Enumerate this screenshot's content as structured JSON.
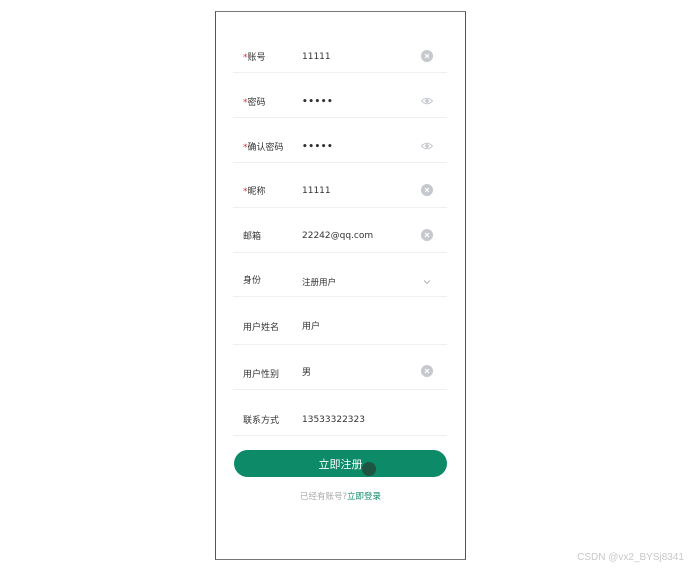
{
  "form": {
    "fields": [
      {
        "key": "account",
        "required": "*",
        "label": "账号",
        "value": "11111",
        "icon": "clear-icon"
      },
      {
        "key": "password",
        "required": "*",
        "label": "密码",
        "value": "•••••",
        "icon": "eye-icon"
      },
      {
        "key": "confirm_password",
        "required": "*",
        "label": "确认密码",
        "value": "•••••",
        "icon": "eye-icon"
      },
      {
        "key": "nickname",
        "required": "*",
        "label": "昵称",
        "value": "11111",
        "icon": "clear-icon"
      },
      {
        "key": "email",
        "required": "",
        "label": "邮箱",
        "value": "22242@qq.com",
        "icon": "clear-icon"
      },
      {
        "key": "identity",
        "required": "",
        "label": "身份",
        "value": "注册用户",
        "icon": "chevron-down-icon"
      },
      {
        "key": "user_name",
        "required": "",
        "label": "用户姓名",
        "value": "用户",
        "icon": ""
      },
      {
        "key": "gender",
        "required": "",
        "label": "用户性别",
        "value": "男",
        "icon": "clear-icon"
      },
      {
        "key": "contact",
        "required": "",
        "label": "联系方式",
        "value": "13533322323",
        "icon": ""
      }
    ],
    "submit_label": "立即注册",
    "login_prompt": "已经有账号?",
    "login_link": "立即登录"
  },
  "watermark": "CSDN @vx2_BYSj8341",
  "colors": {
    "accent": "#0d8a67",
    "required_mark": "#e0303a",
    "icon_gray": "#c5c8cc"
  }
}
